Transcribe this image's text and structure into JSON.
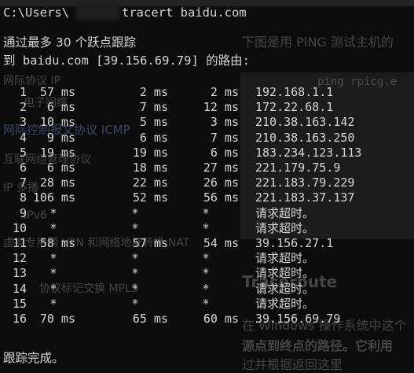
{
  "console": {
    "prompt": "C:\\Users\\",
    "command": "tracert baidu.com",
    "header_line1": "通过最多 30 个跃点跟踪",
    "header_line2": "到 baidu.com [39.156.69.79] 的路由:",
    "footer": "跟踪完成。",
    "timeout_text": "请求超时。"
  },
  "hops": [
    {
      "n": "1",
      "t1": "57 ms",
      "t2": "2 ms",
      "t3": "2 ms",
      "addr": "192.168.1.1"
    },
    {
      "n": "2",
      "t1": "6 ms",
      "t2": "7 ms",
      "t3": "12 ms",
      "addr": "172.22.68.1"
    },
    {
      "n": "3",
      "t1": "10 ms",
      "t2": "5 ms",
      "t3": "3 ms",
      "addr": "210.38.163.142"
    },
    {
      "n": "4",
      "t1": "9 ms",
      "t2": "6 ms",
      "t3": "7 ms",
      "addr": "210.38.163.250"
    },
    {
      "n": "5",
      "t1": "19 ms",
      "t2": "19 ms",
      "t3": "6 ms",
      "addr": "183.234.123.113"
    },
    {
      "n": "6",
      "t1": "6 ms",
      "t2": "18 ms",
      "t3": "27 ms",
      "addr": "221.179.75.9"
    },
    {
      "n": "7",
      "t1": "28 ms",
      "t2": "22 ms",
      "t3": "26 ms",
      "addr": "221.183.79.229"
    },
    {
      "n": "8",
      "t1": "106 ms",
      "t2": "52 ms",
      "t3": "56 ms",
      "addr": "221.183.37.137"
    },
    {
      "n": "9",
      "t1": "*",
      "t2": "*",
      "t3": "*",
      "addr": "请求超时。"
    },
    {
      "n": "10",
      "t1": "*",
      "t2": "*",
      "t3": "*",
      "addr": "请求超时。"
    },
    {
      "n": "11",
      "t1": "58 ms",
      "t2": "57 ms",
      "t3": "54 ms",
      "addr": "39.156.27.1"
    },
    {
      "n": "12",
      "t1": "*",
      "t2": "*",
      "t3": "*",
      "addr": "请求超时。"
    },
    {
      "n": "13",
      "t1": "*",
      "t2": "*",
      "t3": "*",
      "addr": "请求超时。"
    },
    {
      "n": "14",
      "t1": "*",
      "t2": "*",
      "t3": "*",
      "addr": "请求超时。"
    },
    {
      "n": "15",
      "t1": "*",
      "t2": "*",
      "t3": "*",
      "addr": "请求超时。"
    },
    {
      "n": "16",
      "t1": "70 ms",
      "t2": "65 ms",
      "t3": "60 ms",
      "addr": "39.156.69.79"
    }
  ],
  "background_page": {
    "caption": "下图是用 PING 测试主机的",
    "side_items": [
      "网际协议 IP",
      "电子网络",
      "网际控制报文协议 ICMP",
      "互联网组管理协议",
      "IP 多播",
      "IPv6",
      "虚拟专用网 VPN 和网络地址转换 NAT",
      "协议标记交换 MPLS"
    ],
    "heading": "Traceroute",
    "para1": "在 Windows 操作系统中这个",
    "para2": "源点到终点的路径。它利用",
    "para3": "过并根据返回这里",
    "ping_line": "ping rpicg.e"
  }
}
